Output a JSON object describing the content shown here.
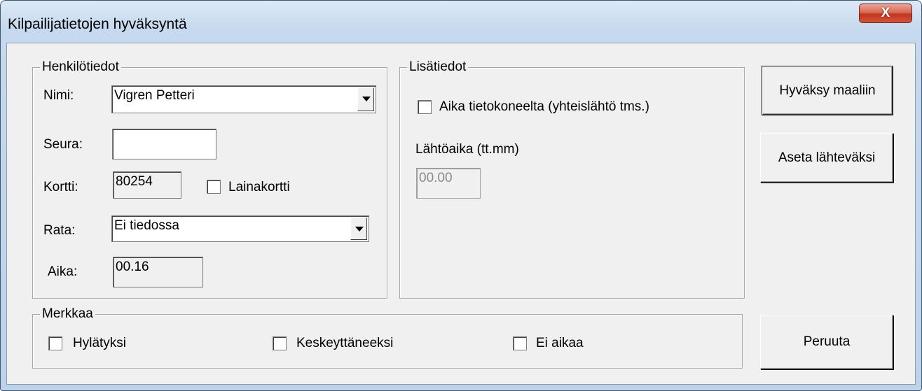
{
  "window": {
    "title": "Kilpailijatietojen hyväksyntä",
    "close_glyph": "X"
  },
  "personal": {
    "legend": "Henkilötiedot",
    "name_label": "Nimi:",
    "name_value": "Vigren Petteri",
    "club_label": "Seura:",
    "club_value": "",
    "card_label": "Kortti:",
    "card_value": "80254",
    "loan_card_label": "Lainakortti",
    "loan_card_checked": false,
    "course_label": "Rata:",
    "course_value": "Ei tiedossa",
    "time_label": "Aika:",
    "time_value": "00.16"
  },
  "extra": {
    "legend": "Lisätiedot",
    "computer_time_label": "Aika tietokoneelta (yhteislähtö tms.)",
    "computer_time_checked": false,
    "start_time_label": "Lähtöaika (tt.mm)",
    "start_time_value": "00.00"
  },
  "mark": {
    "legend": "Merkkaa",
    "disqualified_label": "Hylätyksi",
    "dnf_label": "Keskeyttäneeksi",
    "no_time_label": "Ei aikaa"
  },
  "buttons": {
    "accept": "Hyväksy maaliin",
    "set_start": "Aseta lähteväksi",
    "cancel": "Peruuta"
  },
  "icons": {
    "close": "close-icon",
    "dropdown": "chevron-down-icon",
    "checkbox": "checkbox-icon"
  }
}
